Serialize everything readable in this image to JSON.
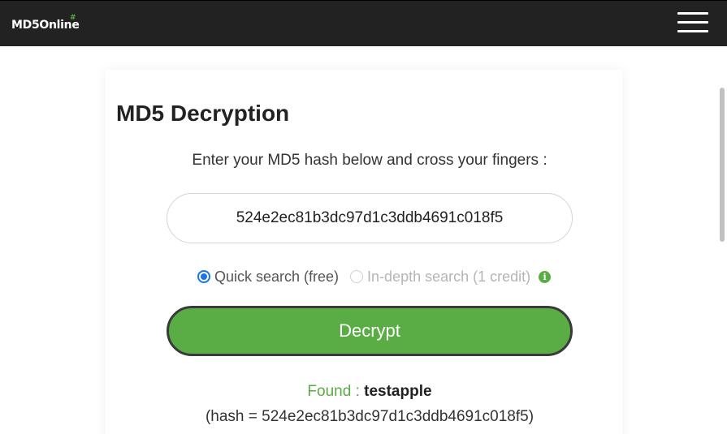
{
  "header": {
    "logo_text": "MD5Online",
    "logo_mark": "#",
    "menu_icon": "hamburger-menu-icon"
  },
  "main": {
    "title": "MD5 Decryption",
    "instruction": "Enter your MD5 hash below and cross your fingers :",
    "hash_input_value": "524e2ec81b3dc97d1c3ddb4691c018f5",
    "options": [
      {
        "label": "Quick search (free)",
        "checked": true,
        "disabled": false
      },
      {
        "label": "In-depth search (1 credit)",
        "checked": false,
        "disabled": true
      }
    ],
    "info_icon": "info-icon",
    "decrypt_label": "Decrypt",
    "result": {
      "found_label": "Found :",
      "found_value": "testapple",
      "hash_line": "(hash = 524e2ec81b3dc97d1c3ddb4691c018f5)"
    }
  },
  "colors": {
    "brand_green": "#5aac44",
    "navbar_bg": "#222222",
    "radio_blue": "#1a73e8"
  }
}
